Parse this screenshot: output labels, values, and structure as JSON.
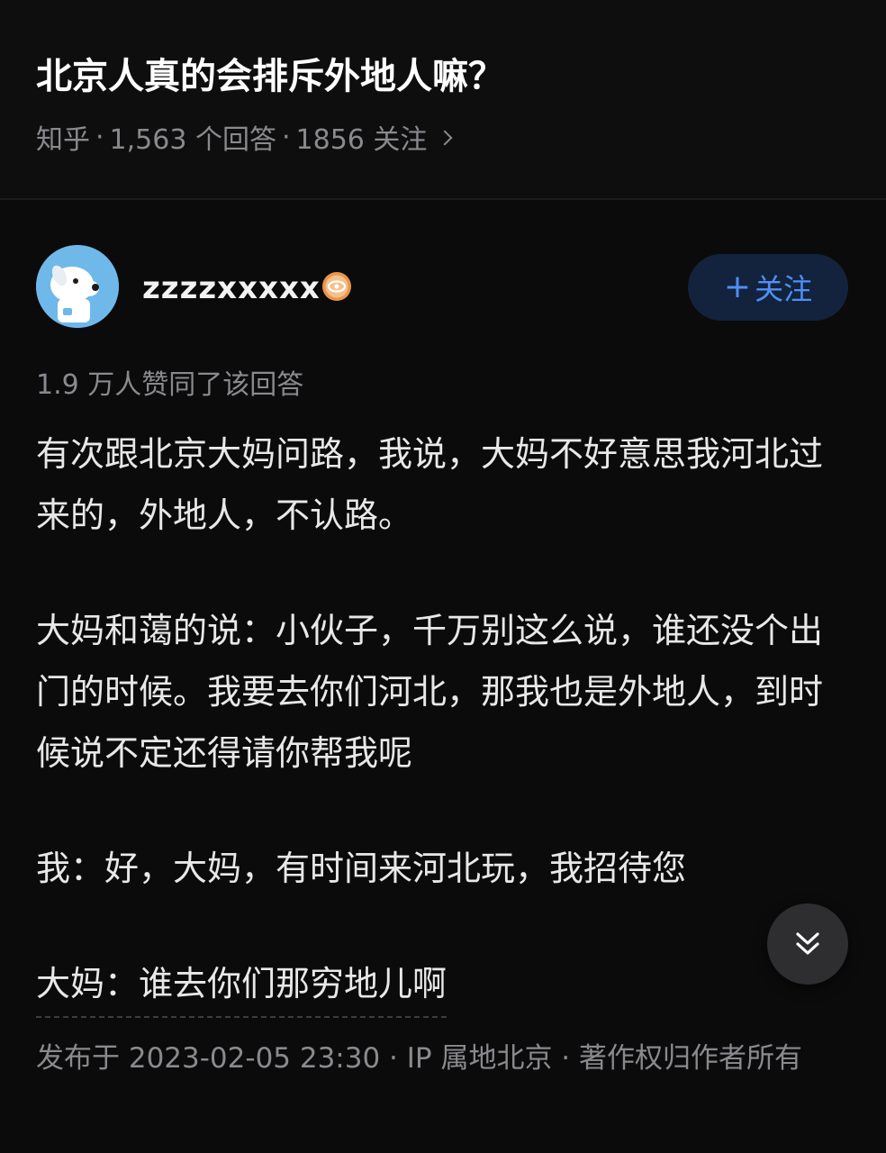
{
  "question": {
    "title": "北京人真的会排斥外地人嘛？",
    "source": "知乎",
    "answer_count": "1,563 个回答",
    "follow_count": "1856 关注",
    "separator": "·"
  },
  "author": {
    "name": "zzzzxxxxx",
    "avatar_icon": "dog-avatar-icon",
    "badge_icon": "eye-badge-icon",
    "follow_label": "关注",
    "follow_plus": "+"
  },
  "answer": {
    "vote_summary": "1.9 万人赞同了该回答",
    "paragraphs": [
      "有次跟北京大妈问路，我说，大妈不好意思我河北过来的，外地人，不认路。",
      "大妈和蔼的说：小伙子，千万别这么说，谁还没个出门的时候。我要去你们河北，那我也是外地人，到时候说不定还得请你帮我呢",
      "我：好，大妈，有时间来河北玩，我招待您",
      "大妈：谁去你们那穷地儿啊"
    ],
    "publish_info": "发布于 2023-02-05 23:30 · IP 属地北京 · 著作权归作者所有"
  },
  "colors": {
    "background": "#0b0b0c",
    "accent_blue": "#4f8ff5",
    "muted_text": "#8a8a8e"
  }
}
